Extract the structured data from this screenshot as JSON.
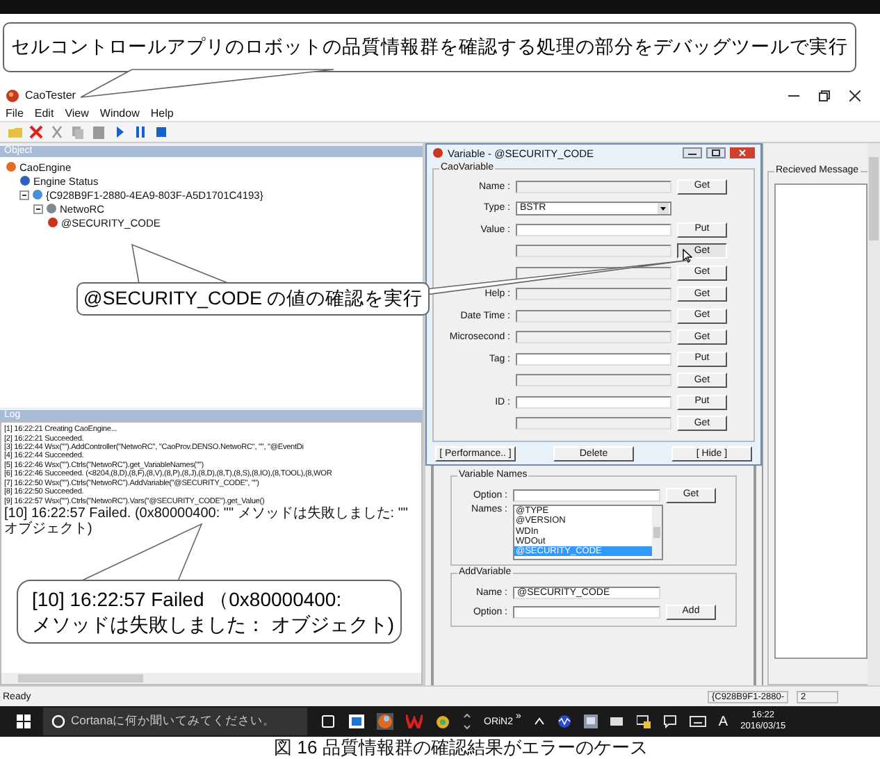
{
  "top_callout": "セルコントロールアプリのロボットの品質情報群を確認する処理の部分をデバッグツールで実行",
  "tree_callout": "@SECURITY_CODE の値の確認を実行",
  "log_callout": [
    "[10] 16:22:57 Failed （0x80000400:",
    "メソッドは失敗しました： オブジェクト)"
  ],
  "window": {
    "title": "CaoTester"
  },
  "menu": [
    "File",
    "Edit",
    "View",
    "Window",
    "Help"
  ],
  "object_panel": {
    "header": "Object",
    "tree": [
      {
        "label": "CaoEngine",
        "kind": "engine",
        "children": [
          {
            "label": "Engine Status",
            "kind": "status"
          },
          {
            "label": "{C928B9F1-2880-4EA9-803F-A5D1701C4193}",
            "kind": "workspace",
            "expanded": true,
            "children": [
              {
                "label": "NetwoRC",
                "kind": "controller",
                "expanded": true,
                "children": [
                  {
                    "label": "@SECURITY_CODE",
                    "kind": "variable"
                  }
                ]
              }
            ]
          }
        ]
      }
    ]
  },
  "log_panel": {
    "header": "Log",
    "lines": [
      "[1]  16:22:21 Creating CaoEngine...",
      "[2]  16:22:21 Succeeded.",
      "[3]  16:22:44 Wsx(\"\").AddController(\"NetwoRC\", \"CaoProv.DENSO.NetwoRC\", \"\", \"@EventDi",
      "[4]  16:22:44 Succeeded.",
      "[5]  16:22:46 Wsx(\"\").Ctrls(\"NetwoRC\").get_VariableNames(\"\")",
      "[6]  16:22:46 Succeeded. (<8204,(8,D),(8,F),(8,V),(8,P),(8,J),(8,D),(8,T),(8,S),(8,IO),(8,TOOL),(8,WOR",
      "[7]  16:22:50 Wsx(\"\").Ctrls(\"NetwoRC\").AddVariable(\"@SECURITY_CODE\", \"\")",
      "[8]  16:22:50 Succeeded.",
      "[9]  16:22:57 Wsx(\"\").Ctrls(\"NetwoRC\").Vars(\"@SECURITY_CODE\").get_Value()",
      "[10] 16:22:57 Failed. (0x80000400: \"\" メソッドは失敗しました: \"\" オブジェクト)"
    ]
  },
  "variable_dialog": {
    "title": "Variable - @SECURITY_CODE",
    "group": "CaoVariable",
    "rows": [
      {
        "label": "Name :",
        "kind": "readonly",
        "button": "Get",
        "pressed": false
      },
      {
        "label": "Type :",
        "kind": "dropdown",
        "value": "BSTR"
      },
      {
        "label": "Value :",
        "kind": "input",
        "button": "Put",
        "pressed": false
      },
      {
        "kind": "readonly",
        "button": "Get",
        "pressed": true
      },
      {
        "kind": "readonly",
        "button": "Get",
        "pressed": false
      },
      {
        "label": "Help :",
        "kind": "readonly",
        "button": "Get",
        "pressed": false
      },
      {
        "label": "Date Time :",
        "kind": "readonly",
        "button": "Get",
        "pressed": false
      },
      {
        "label": "Microsecond :",
        "kind": "readonly",
        "button": "Get",
        "pressed": false
      },
      {
        "label": "Tag :",
        "kind": "input",
        "button": "Put",
        "pressed": false
      },
      {
        "kind": "readonly",
        "button": "Get",
        "pressed": false
      },
      {
        "label": "ID :",
        "kind": "input",
        "button": "Put",
        "pressed": false
      },
      {
        "kind": "readonly",
        "button": "Get",
        "pressed": false
      }
    ],
    "footer": [
      "[ Performance.. ]",
      "Delete",
      "[ Hide ]"
    ]
  },
  "received_panel": {
    "group": "Recieved Message"
  },
  "variable_names": {
    "group": "Variable Names",
    "option_label": "Option :",
    "button": "Get",
    "names_label": "Names :",
    "names": [
      {
        "label": "@TYPE",
        "selected": false
      },
      {
        "label": "@VERSION",
        "selected": false
      },
      {
        "label": "WDIn",
        "selected": false
      },
      {
        "label": "WDOut",
        "selected": false
      },
      {
        "label": "@SECURITY_CODE",
        "selected": true
      }
    ]
  },
  "add_variable": {
    "group": "AddVariable",
    "name_label": "Name :",
    "name_value": "@SECURITY_CODE",
    "option_label": "Option :",
    "button": "Add"
  },
  "status_bar": {
    "text": "Ready",
    "panes": [
      "{C928B9F1-2880-",
      "2"
    ]
  },
  "taskbar": {
    "search_placeholder": "Cortanaに何か聞いてみてください。",
    "toolbar_label": "ORiN2",
    "chevron": "»",
    "ime": "A",
    "time": "16:22",
    "date": "2016/03/15"
  },
  "caption": "図 16  品質情報群の確認結果がエラーのケース"
}
